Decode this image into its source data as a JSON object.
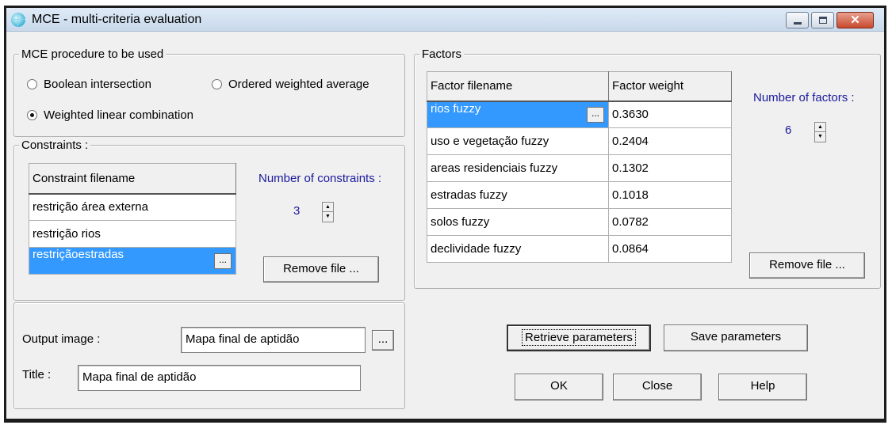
{
  "window": {
    "title": "MCE - multi-criteria evaluation",
    "close_glyph": "✕"
  },
  "procedure": {
    "legend": "MCE procedure to be used",
    "options": [
      {
        "label": "Boolean intersection",
        "selected": false
      },
      {
        "label": "Ordered weighted average",
        "selected": false
      },
      {
        "label": "Weighted linear combination",
        "selected": true
      }
    ]
  },
  "constraints": {
    "legend": "Constraints :",
    "column_header": "Constraint filename",
    "rows": [
      "restrição área externa",
      "restrição rios",
      "restriçãoestradas"
    ],
    "selected_index": 2,
    "count_label": "Number of constraints :",
    "count": "3",
    "remove_label": "Remove file ..."
  },
  "factors": {
    "legend": "Factors",
    "headers": {
      "filename": "Factor filename",
      "weight": "Factor weight"
    },
    "rows": [
      {
        "name": "rios fuzzy",
        "weight": "0.3630"
      },
      {
        "name": "uso e vegetação fuzzy",
        "weight": "0.2404"
      },
      {
        "name": "areas residenciais fuzzy",
        "weight": "0.1302"
      },
      {
        "name": "estradas fuzzy",
        "weight": "0.1018"
      },
      {
        "name": "solos fuzzy",
        "weight": "0.0782"
      },
      {
        "name": "declividade fuzzy",
        "weight": "0.0864"
      }
    ],
    "selected_index": 0,
    "count_label": "Number of factors :",
    "count": "6",
    "remove_label": "Remove file ..."
  },
  "output": {
    "image_label": "Output image :",
    "image_value": "Mapa final de aptidão",
    "title_label": "Title :",
    "title_value": "Mapa final de aptidão"
  },
  "buttons": {
    "ellipsis": "...",
    "retrieve": "Retrieve parameters",
    "save": "Save parameters",
    "ok": "OK",
    "close": "Close",
    "help": "Help"
  },
  "icons": {
    "app": "globe-icon",
    "minimize": "minimize-icon",
    "maximize": "maximize-icon",
    "close": "close-icon",
    "spin_up": "▲",
    "spin_down": "▼"
  }
}
